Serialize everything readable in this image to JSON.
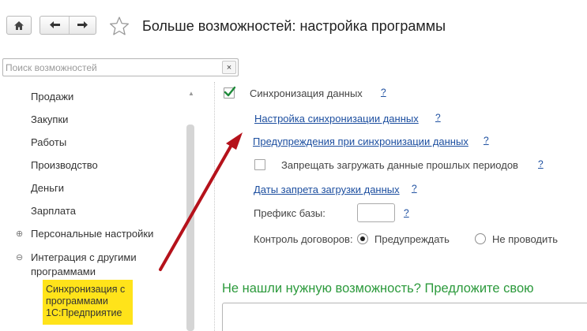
{
  "header": {
    "home_icon": "home-icon",
    "back_icon": "arrow-left-icon",
    "forward_icon": "arrow-right-icon",
    "favorite_icon": "star-icon",
    "title": "Больше возможностей: настройка программы"
  },
  "search": {
    "placeholder": "Поиск возможностей",
    "value": "",
    "clear_label": "×"
  },
  "sidebar": {
    "items": [
      {
        "label": "Продажи"
      },
      {
        "label": "Закупки"
      },
      {
        "label": "Работы"
      },
      {
        "label": "Производство"
      },
      {
        "label": "Деньги"
      },
      {
        "label": "Зарплата"
      },
      {
        "label": "Персональные настройки",
        "expander": "⊕"
      },
      {
        "label": "Интеграция с другими",
        "label2": "программами",
        "expander": "⊖"
      }
    ],
    "selected": {
      "line1": "Синхронизация с",
      "line2": "программами",
      "line3": "1С:Предприятие"
    }
  },
  "main": {
    "sync_checkbox": {
      "label": "Синхронизация данных",
      "checked": true,
      "help": "?"
    },
    "sync_settings_link": {
      "label": "Настройка синхронизации данных",
      "help": "?"
    },
    "sync_warnings_link": {
      "label": "Предупреждения при синхронизации данных",
      "help": "?"
    },
    "forbid_checkbox": {
      "label": "Запрещать загружать данные прошлых периодов",
      "checked": false,
      "help": "?"
    },
    "forbid_dates_link": {
      "label": "Даты запрета загрузки данных",
      "help": "?"
    },
    "prefix": {
      "label": "Префикс базы:",
      "value": "",
      "help": "?"
    },
    "contract_control": {
      "label": "Контроль договоров:",
      "options": [
        {
          "label": "Предупреждать",
          "selected": true
        },
        {
          "label": "Не проводить",
          "selected": false
        }
      ]
    },
    "suggest": {
      "title": "Не нашли нужную возможность? Предложите свою",
      "value": ""
    }
  },
  "colors": {
    "link": "#1d4fa0",
    "highlight": "#ffe31a",
    "suggest_title": "#2c9a3c",
    "annotation_arrow": "#b5121b",
    "checkmark": "#1e8a3a"
  }
}
